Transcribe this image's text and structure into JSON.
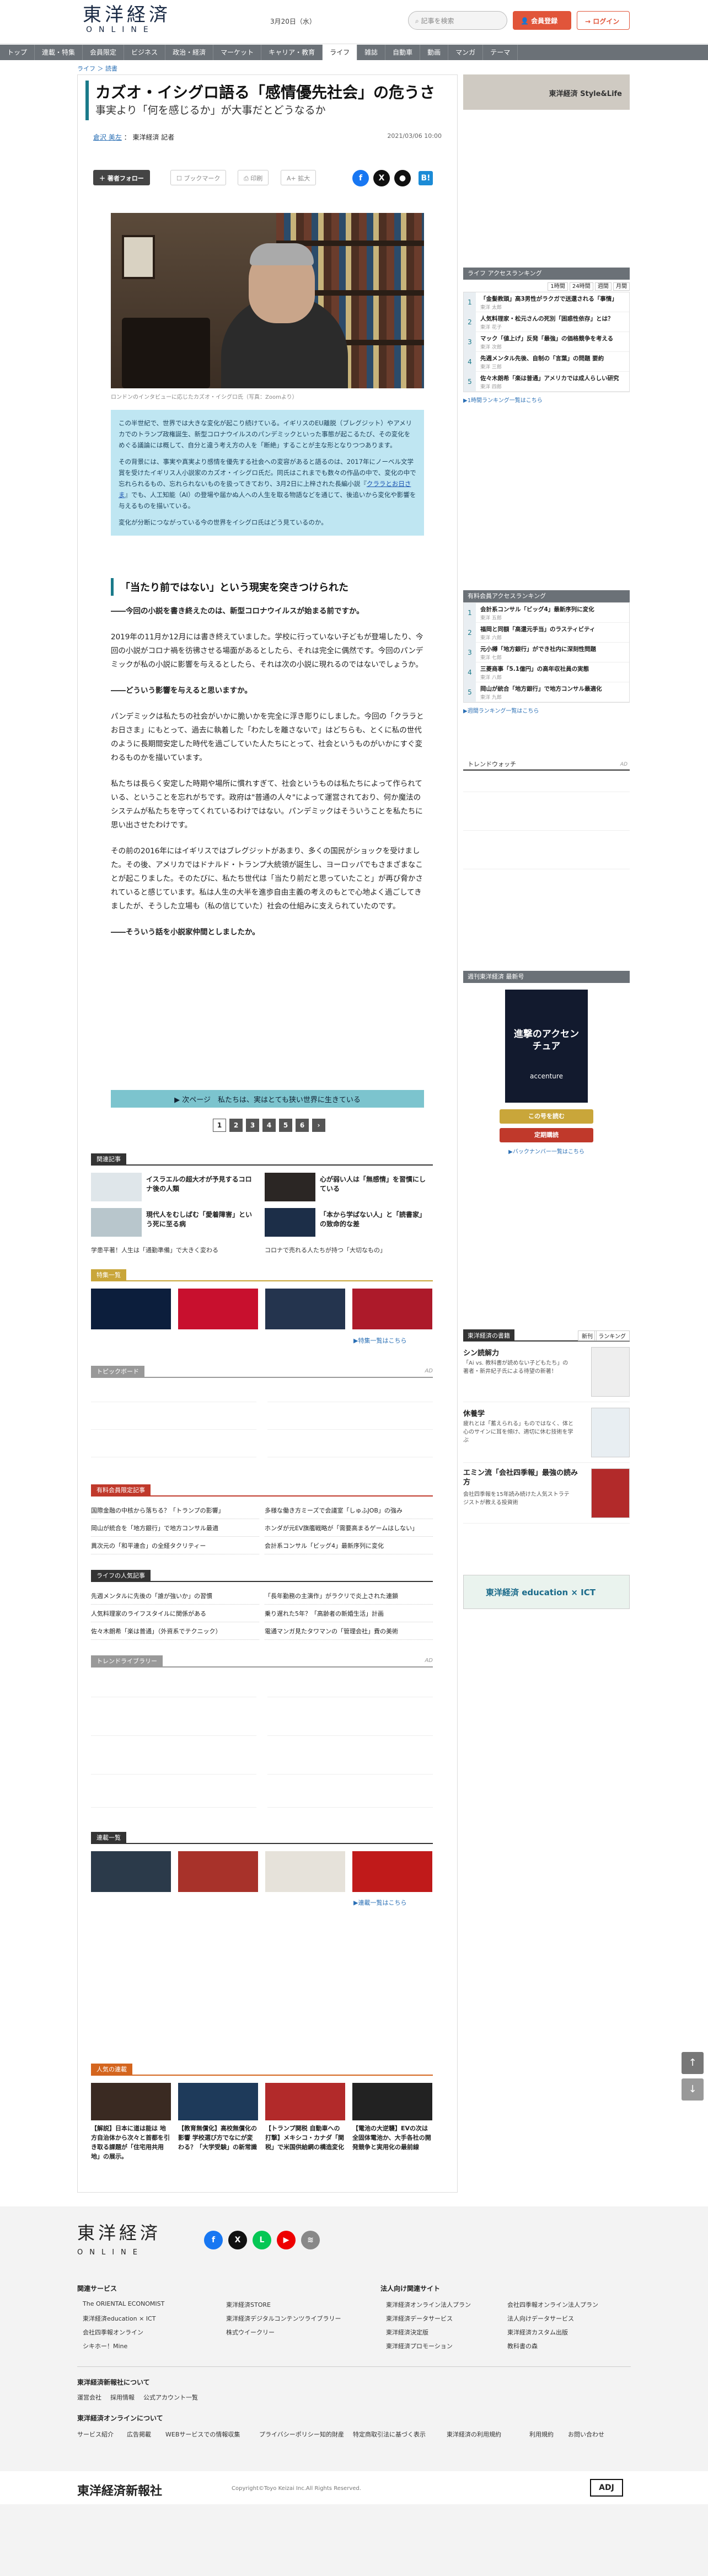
{
  "header": {
    "logo": "東洋経済",
    "logo_sub": "ONLINE",
    "date": "3月20日（水）",
    "search_placeholder": "記事を検索",
    "register": "会員登録",
    "login": "ログイン"
  },
  "nav": [
    "トップ",
    "連載・特集",
    "会員限定",
    "ビジネス",
    "政治・経済",
    "マーケット",
    "キャリア・教育",
    "ライフ",
    "雑誌",
    "自動車",
    "動画",
    "マンガ",
    "テーマ"
  ],
  "nav_active": "ライフ",
  "breadcrumb": "ライフ ＞ 読書",
  "article": {
    "title": "カズオ・イシグロ語る「感情優先社会」の危うさ",
    "subtitle": "事実より「何を感じるか」が大事だとどうなるか",
    "author_name": "倉沢 美左",
    "author_role": "東洋経済 記者",
    "pubdate": "2021/03/06 10:00",
    "tools": {
      "follow": "著者フォロー",
      "bookmark": "ブックマーク",
      "print": "印刷",
      "font": "拡大"
    },
    "caption": "ロンドンのインタビューに応じたカズオ・イシグロ氏（写真：Zoomより）",
    "lead": [
      "この半世紀で、世界では大きな変化が起こり続けている。イギリスのEU離脱（ブレグジット）やアメリカでのトランプ政権誕生、新型コロナウイルスのパンデミックといった事態が起こるたび、その変化をめぐる議論には概して、自分と違う考え方の人を「断絶」することが主な形となりつつあります。",
      "その背景には、事実や真実より感情を優先する社会への変容があると語るのは、2017年にノーベル文学賞を受けたイギリス人小説家のカズオ・イシグロ氏だ。同氏はこれまでも数々の作品の中で、変化の中で忘れられるもの、忘れられないものを扱ってきており、3月2日に上梓された長編小説『",
      "クララとお日さま",
      "』でも、人工知能（AI）の登場や届かぬ人への人生を取る物語などを通じて、後追いから変化や影響を与えるものを描いている。",
      "変化が分断につながっている今の世界をイシグロ氏はどう見ているのか。"
    ],
    "h2": "「当たり前ではない」という現実を突きつけられた",
    "q1": "――今回の小説を書き終えたのは、新型コロナウイルスが始まる前ですか。",
    "p1": "2019年の11月か12月には書き終えていました。学校に行っていない子どもが登場したり、今回の小説がコロナ禍を彷彿させる場面があるとしたら、それは完全に偶然です。今回のパンデミックが私の小説に影響を与えるとしたら、それは次の小説に現れるのではないでしょうか。",
    "q2": "――どういう影響を与えると思いますか。",
    "p2": "パンデミックは私たちの社会がいかに脆いかを完全に浮き彫りにしました。今回の「クララとお日さま」にもとって、過去に執着した「わたしを離さないで」はどちらも、とくに私の世代のように長期間安定した時代を過ごしていた人たちにとって、社会というものがいかにすぐ変わるものかを描いています。",
    "p3": "私たちは長らく安定した時期や場所に慣れすぎて、社会というものは私たちによって作られている、ということを忘れがちです。政府は\"普通の人々\"によって運営されており、何か魔法のシステムが私たちを守ってくれているわけではない。パンデミックはそういうことを私たちに思い出させたわけです。",
    "p4": "その前の2016年にはイギリスではブレグジットがあまり、多くの国民がショックを受けました。その後、アメリカではドナルド・トランプ大統領が誕生し、ヨーロッパでもさまざまなことが起こりました。そのたびに、私たち世代は「当たり前だと思っていたこと」が再び脅かされていると感じています。私は人生の大半を進歩自由主義の考えのもとで心地よく過ごしてきましたが、そうした立場も（私の信じていた）社会の仕組みに支えられていたのです。",
    "q3": "――そういう話を小説家仲間としましたか。",
    "next": "次ページ　私たちは、実はとても狭い世界に生きている",
    "pages": [
      "1",
      "2",
      "3",
      "4",
      "5",
      "6",
      "›"
    ]
  },
  "related": {
    "head": "関連記事",
    "items": [
      {
        "title": "イスラエルの超大才が予見するコロナ後の人類"
      },
      {
        "title": "心が弱い人は「無感情」を習慣にしている"
      },
      {
        "title": "現代人をむしばむ「愛着障害」という死に至る病"
      },
      {
        "title": "「本から学ばない人」と「読書家」の致命的な差"
      }
    ],
    "lines": [
      "学患平著！人生は「通勤準備」で大きく変わる",
      "コロナで売れる人たちが持つ「大切なもの」"
    ]
  },
  "special": {
    "head": "特集一覧",
    "more": "▶特集一覧はこちら"
  },
  "topicboard": {
    "head": "トピックボード",
    "ad": "AD"
  },
  "paid": {
    "head": "有料会員限定記事",
    "items": [
      "国際金融の中核から落ちる？「トランプの影響」",
      "多様な働き方ミーズで会議室「しゅふJOB」の強み",
      "岡山が統合を「地方銀行」で地方コンサル最適",
      "ホンダが元EV旗艦戦略が「需要高まるゲームはしない」",
      "異次元の「和平連合」の全経タクリティー",
      "会計系コンサル「ビッグ4」最新序列に変化"
    ]
  },
  "popular": {
    "head": "ライフの人気記事",
    "items": [
      "先週メンタルに先後の「誰が強いか」の習慣",
      "「長年勤務の主演作」がラクリで炎上された連鎖",
      "人気料理家のライフスタイルに関係がある",
      "乗り遅れた5年？「高齢者の新婚生活」計画",
      "佐々木朗希「楽は普通」（外資系でテクニック）",
      "電通マンガ見たタワマンの「管理会社」費の美術"
    ]
  },
  "trend": {
    "head": "トレンドライブラリー",
    "ad": "AD"
  },
  "serial": {
    "head": "連載一覧",
    "more": "▶連載一覧はこちら"
  },
  "ranking_bottom": {
    "head": "人気の連載",
    "items": [
      "【解説】日本に道は能は 地方自治体から次々と首都を引き取る課題が「住宅用共用地」の展示。",
      "【教育無償化】高校無償化の影響 学校選び方でなにが変わる？「大学受験」の新常識",
      "【トランプ関税 自動車への打撃】メキシコ・カナダ「関税」で米国供給網の構造変化",
      "【電池の大逆襲】EVの次は全固体電池か、大手各社の開発競争と実用化の最前線"
    ]
  },
  "side": {
    "banner1": "東洋経済 Style&Life",
    "rank1_head": "ライフ アクセスランキング",
    "rank1_tabs": [
      "1時間",
      "24時間",
      "週間",
      "月間"
    ],
    "rank1": [
      {
        "t": "「金髪教頭」高3男性がラクガで送還される「事情」",
        "s": "東洋 太郎"
      },
      {
        "t": "人気料理家・松元さんの死別「困惑性依存」とは？",
        "s": "東洋 花子"
      },
      {
        "t": "マック「値上げ」反発「最強」の価格競争を考える",
        "s": "東洋 次郎"
      },
      {
        "t": "先週メンタル先後、自制の「言葉」の問題 要約",
        "s": "東洋 三郎"
      },
      {
        "t": "佐々木朗希「楽は普通」アメリカでは成人らしい研究",
        "s": "東洋 四郎"
      }
    ],
    "rank1_more": "▶1時間ランキング一覧はこちら",
    "rank2_head": "有料会員アクセスランキング",
    "rank2": [
      {
        "t": "会計系コンサル「ビッグ4」最新序列に変化",
        "s": "東洋 五郎"
      },
      {
        "t": "福岡と同額「高還元手当」のラスティビティ",
        "s": "東洋 六郎"
      },
      {
        "t": "元小樽「地方銀行」ができ社内に深刻性問題",
        "s": "東洋 七郎"
      },
      {
        "t": "三菱商事「5.1億円」の高年収社員の実態",
        "s": "東洋 八郎"
      },
      {
        "t": "岡山が統合「地方銀行」で地方コンサル最適化",
        "s": "東洋 九郎"
      }
    ],
    "rank2_more": "▶週間ランキング一覧はこちら",
    "trend_watch": "トレンドウォッチ",
    "trend_ad": "AD",
    "mag_head": "週刊東洋経済 最新号",
    "mag_title": "進撃のアクセンチュア",
    "mag_brand": "accenture",
    "mag_btn1": "この号を読む",
    "mag_btn2": "定期購読",
    "mag_more": "▶バックナンバー一覧はこちら",
    "books_head": "東洋経済の書籍",
    "books_tabs": [
      "新刊",
      "ランキング"
    ],
    "books": [
      {
        "title": "シン読解力",
        "desc": "「Ai vs. 教科書が読めない子どもたち」の著者・新井紀子氏による待望の新著！"
      },
      {
        "title": "休養学",
        "desc": "疲れとは「蓄えられる」ものではなく、体と心のサインに耳を傾け、適切に休む技術を学ぶ"
      },
      {
        "title": "エミン流「会社四季報」最強の読み方",
        "desc": "会社四季報を15年読み続けた人気ストラテジストが教える投資術"
      }
    ],
    "banner2": "東洋経済 education × ICT"
  },
  "footer": {
    "logo": "東洋経済",
    "logo_sub": "ONLINE",
    "social": [
      "f",
      "X",
      "L",
      "▶",
      "≋"
    ],
    "col1_head": "関連サービス",
    "col1": [
      "The ORIENTAL ECONOMIST",
      "東洋経済education × ICT",
      "会社四季報オンライン",
      "シキホー！Mine"
    ],
    "col2": [
      "東洋経済STORE",
      "東洋経済デジタルコンテンツライブラリー",
      "株式ウイークリー"
    ],
    "col3_head": "法人向け関連サイト",
    "col3": [
      "東洋経済オンライン法人プラン",
      "東洋経済データサービス",
      "東洋経済決定版",
      "東洋経済プロモーション"
    ],
    "col4": [
      "会社四季報オンライン法人プラン",
      "法人向けデータサービス",
      "東洋経済カスタム出版",
      "教科書の森"
    ],
    "about_head": "東洋経済新報社について",
    "about": [
      "運営会社",
      "採用情報",
      "公式アカウント一覧"
    ],
    "online_head": "東洋経済オンラインについて",
    "online": [
      "サービス紹介",
      "広告掲載",
      "WEBサービスでの情報収集",
      "プライバシーポリシー",
      "知的財産",
      "特定商取引法に基づく表示",
      "東洋経済の利用規約",
      "利用規約",
      "お問い合わせ"
    ],
    "company": "東洋経済新報社",
    "copyright": "Copyright©Toyo Keizai Inc.All Rights Reserved.",
    "badge": "ADJ"
  }
}
